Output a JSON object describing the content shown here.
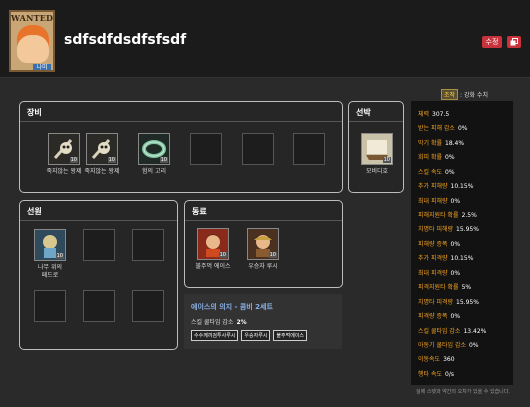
{
  "header": {
    "portrait_wanted": "WANTED",
    "portrait_name_tag": "나미",
    "character_name": "sdfsdfdsdfsfsdf",
    "edit_label": "수정",
    "enhance_tag": "조작",
    "enhance_label": ": 강화 수치"
  },
  "equipment": {
    "title": "장비",
    "items": [
      {
        "label": "죽지않는 왕제",
        "level": "10"
      },
      {
        "label": "죽지않는 왕제",
        "level": "10"
      },
      {
        "label": "험의 고리",
        "level": "10"
      }
    ]
  },
  "ship": {
    "title": "선박",
    "items": [
      {
        "label": "모비디호",
        "level": "10"
      }
    ]
  },
  "crew_member": {
    "title": "선원",
    "items": [
      {
        "label": "나무 위의\n페드로",
        "level": "10"
      }
    ]
  },
  "companion": {
    "title": "동료",
    "items": [
      {
        "label": "불주먹 에이스",
        "level": "10"
      },
      {
        "label": "우승자 루시",
        "level": "10"
      }
    ]
  },
  "set_bonus": {
    "title": "에이스의 의지 - 콤비 2세트",
    "effect_label": "스킬 쿨타임 감소",
    "effect_value": "2%",
    "members": [
      "수수께끼검투사루시",
      "우승자루시",
      "불주먹에이스"
    ]
  },
  "stats": [
    {
      "label": "체력",
      "value": "307.5"
    },
    {
      "label": "받는 피해 감소",
      "value": "0%"
    },
    {
      "label": "막기 확률",
      "value": "18.4%"
    },
    {
      "label": "회피 확률",
      "value": "0%"
    },
    {
      "label": "스킬 속도",
      "value": "0%"
    },
    {
      "label": "추가 피해량",
      "value": "10.15%"
    },
    {
      "label": "최대 피해량",
      "value": "0%"
    },
    {
      "label": "피해지원타 확률",
      "value": "2.5%"
    },
    {
      "label": "치명타 피해량",
      "value": "15.95%"
    },
    {
      "label": "피해량 증폭",
      "value": "0%"
    },
    {
      "label": "추가 피격량",
      "value": "10.15%"
    },
    {
      "label": "최대 피격량",
      "value": "0%"
    },
    {
      "label": "피격지원타 확률",
      "value": "5%"
    },
    {
      "label": "치명타 피격량",
      "value": "15.95%"
    },
    {
      "label": "피격량 증폭",
      "value": "0%"
    },
    {
      "label": "스킬 쿨타임 감소",
      "value": "13.42%"
    },
    {
      "label": "아동기 쿨타임 감소",
      "value": "0%"
    },
    {
      "label": "이동속도",
      "value": "360"
    },
    {
      "label": "행타 속도",
      "value": "0/s"
    }
  ],
  "footnote": "실제 스탯과 약간의 오차가 있을 수 있습니다."
}
